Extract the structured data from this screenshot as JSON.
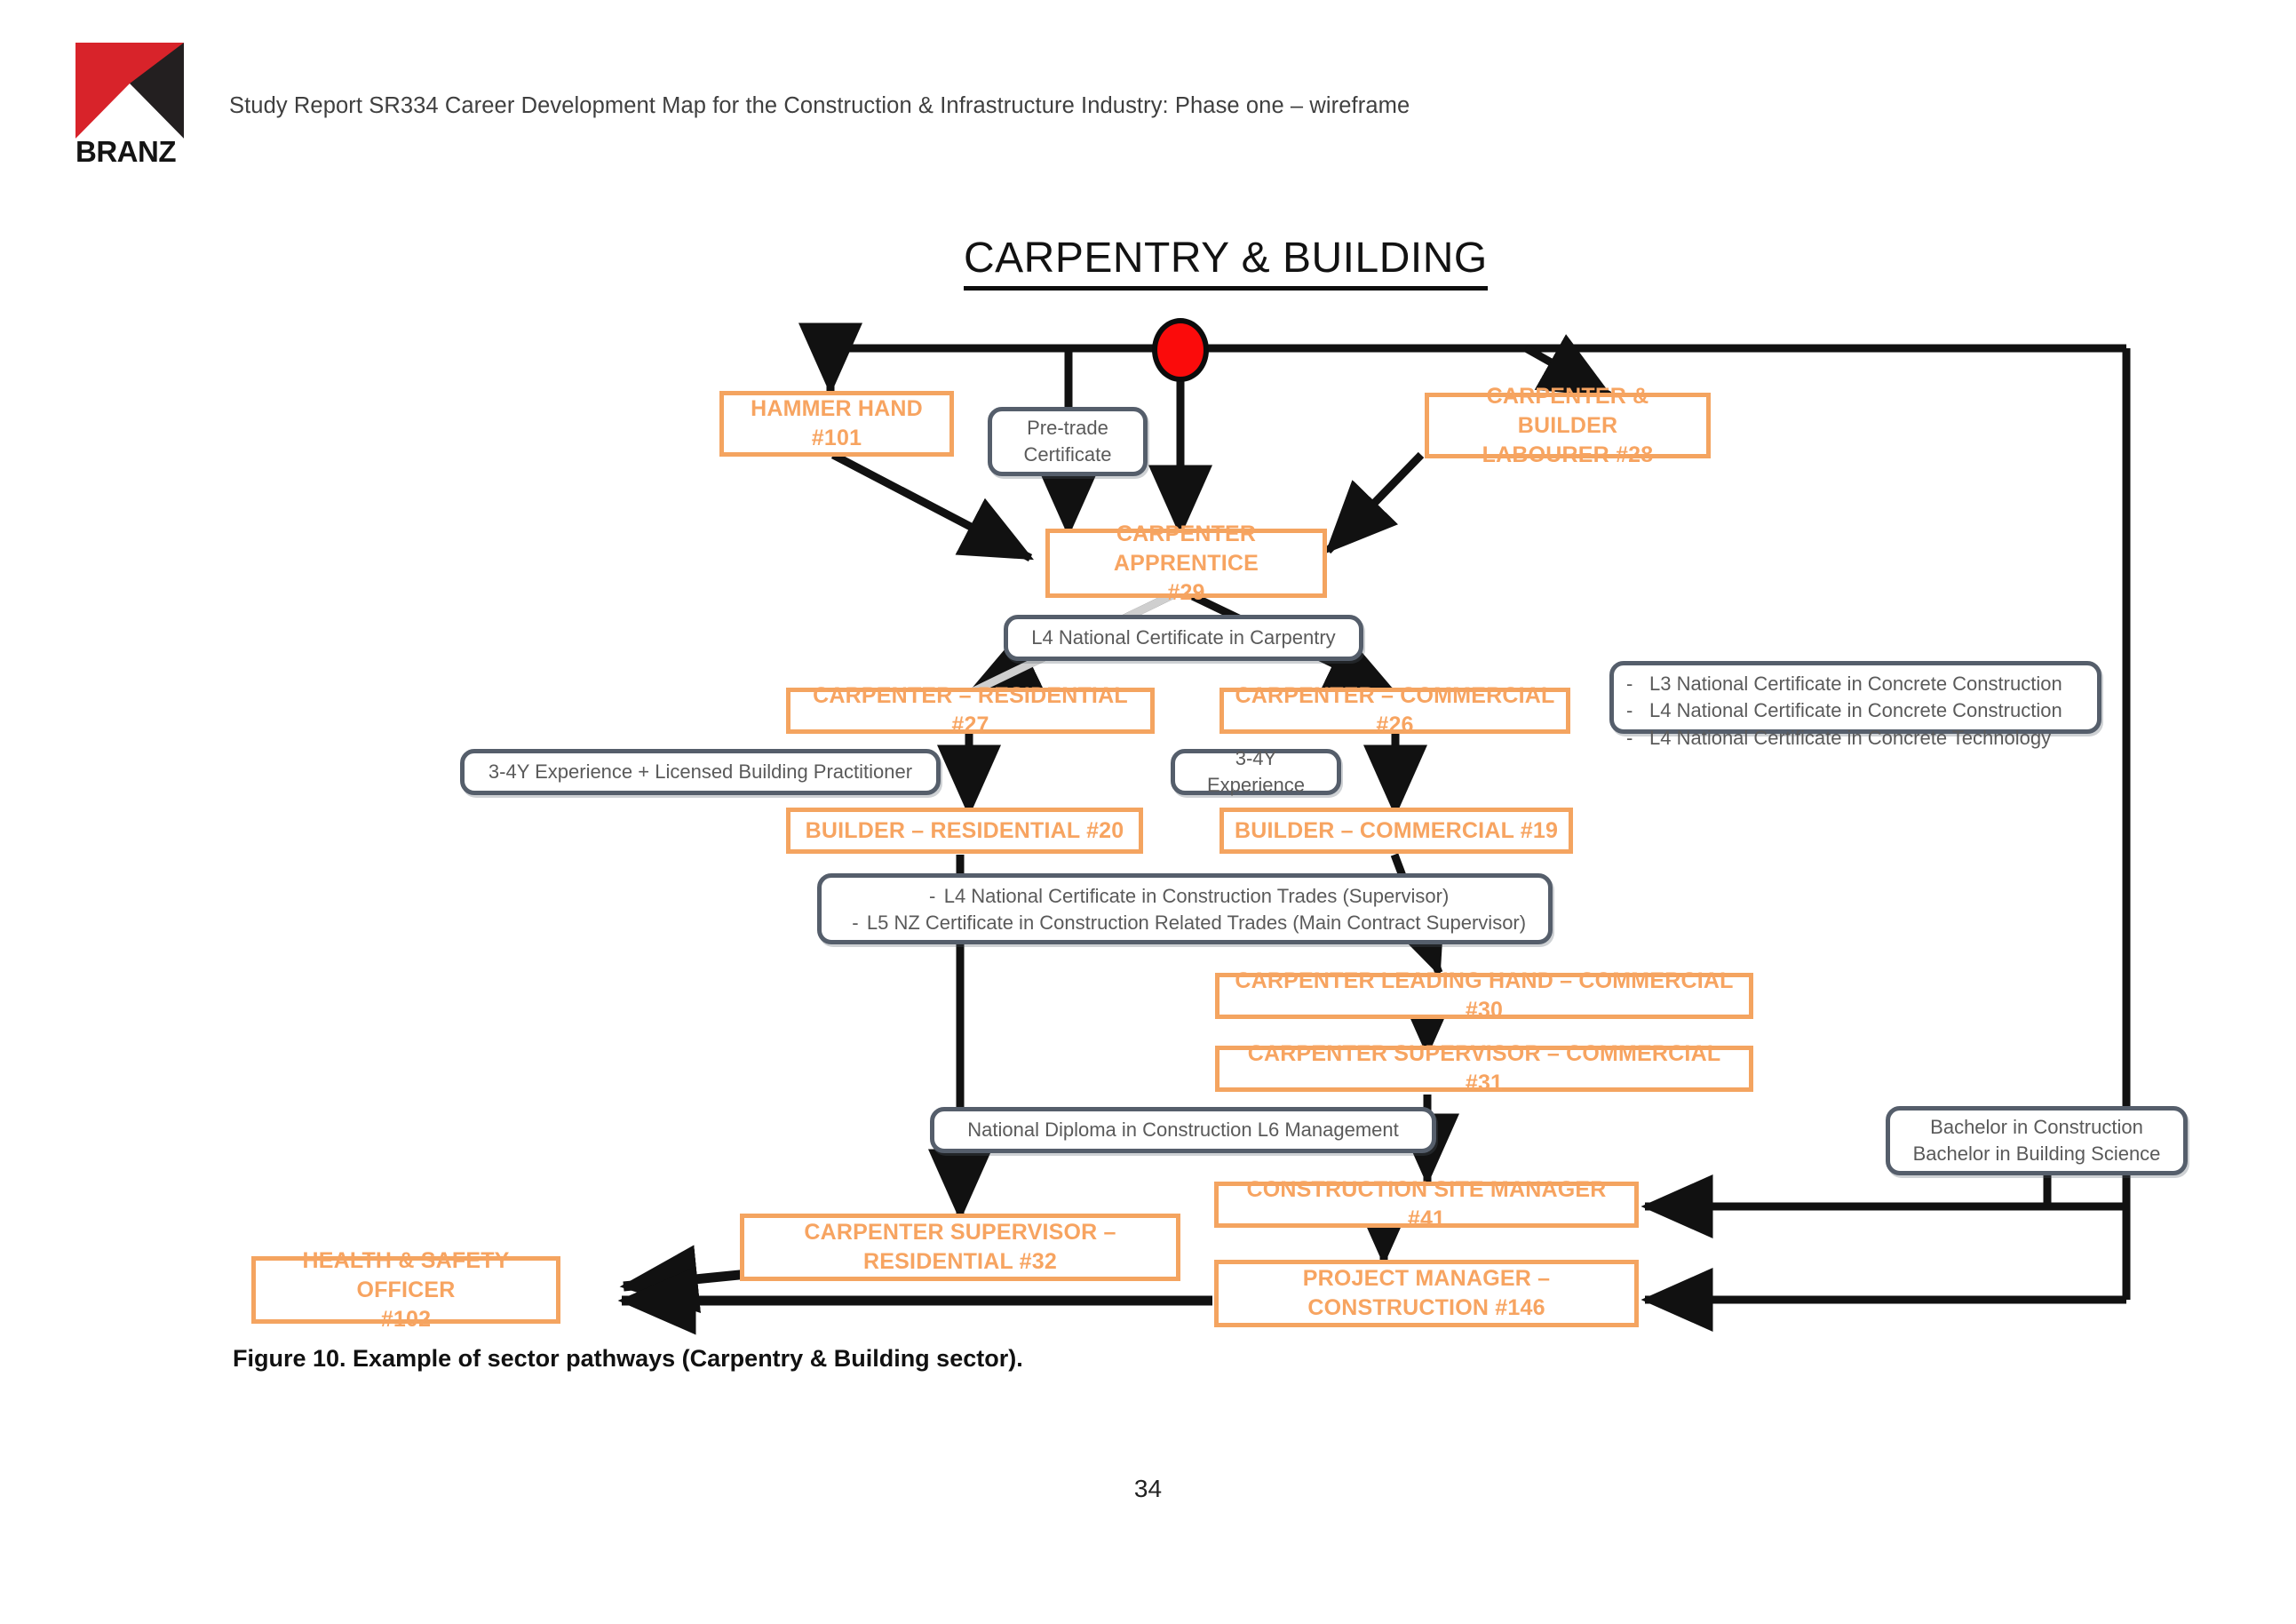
{
  "header": {
    "logo_wordmark": "BRANZ",
    "logo_icon": "branz-triangle-logo",
    "report_title": "Study Report SR334 Career Development Map for the Construction & Infrastructure Industry: Phase one – wireframe"
  },
  "diagram": {
    "section_title": "CARPENTRY & BUILDING",
    "start_marker": "red-start-node",
    "roles": [
      {
        "id": "hammer-hand",
        "label": "HAMMER HAND\n#101",
        "line1": "HAMMER HAND",
        "line2": "#101"
      },
      {
        "id": "carpenter-builder-labourer",
        "label": "CARPENTER & BUILDER LABOURER #28",
        "line1": "CARPENTER & BUILDER",
        "line2": "LABOURER #28"
      },
      {
        "id": "carpenter-apprentice",
        "label": "CARPENTER APPRENTICE #29",
        "line1": "CARPENTER APPRENTICE",
        "line2": "#29"
      },
      {
        "id": "carpenter-residential",
        "label": "CARPENTER – RESIDENTIAL #27",
        "line1": "CARPENTER – RESIDENTIAL #27",
        "line2": ""
      },
      {
        "id": "carpenter-commercial",
        "label": "CARPENTER – COMMERCIAL #26",
        "line1": "CARPENTER – COMMERCIAL #26",
        "line2": ""
      },
      {
        "id": "builder-residential",
        "label": "BUILDER – RESIDENTIAL #20",
        "line1": "BUILDER – RESIDENTIAL #20",
        "line2": ""
      },
      {
        "id": "builder-commercial",
        "label": "BUILDER – COMMERCIAL #19",
        "line1": "BUILDER – COMMERCIAL #19",
        "line2": ""
      },
      {
        "id": "carpenter-leading-hand-commercial",
        "label": "CARPENTER LEADING HAND – COMMERCIAL #30",
        "line1": "CARPENTER LEADING HAND – COMMERCIAL #30",
        "line2": ""
      },
      {
        "id": "carpenter-supervisor-commercial",
        "label": "CARPENTER SUPERVISOR – COMMERCIAL #31",
        "line1": "CARPENTER SUPERVISOR – COMMERCIAL #31",
        "line2": ""
      },
      {
        "id": "carpenter-supervisor-residential",
        "label": "CARPENTER SUPERVISOR – RESIDENTIAL #32",
        "line1": "CARPENTER SUPERVISOR –",
        "line2": "RESIDENTIAL #32"
      },
      {
        "id": "construction-site-manager",
        "label": "CONSTRUCTION SITE MANAGER #41",
        "line1": "CONSTRUCTION SITE MANAGER #41",
        "line2": ""
      },
      {
        "id": "project-manager-construction",
        "label": "PROJECT MANAGER – CONSTRUCTION #146",
        "line1": "PROJECT MANAGER –",
        "line2": "CONSTRUCTION #146"
      },
      {
        "id": "health-safety-officer",
        "label": "HEALTH & SAFETY OFFICER #102",
        "line1": "HEALTH & SAFETY OFFICER",
        "line2": "#102"
      }
    ],
    "qualifications": [
      {
        "id": "pre-trade-certificate",
        "line1": "Pre-trade",
        "line2": "Certificate"
      },
      {
        "id": "l4-national-certificate-carpentry",
        "line1": "L4 National Certificate in Carpentry"
      },
      {
        "id": "concrete-certificates",
        "line1": "L3 National Certificate in Concrete Construction",
        "line2": "L4 National Certificate in Concrete Construction",
        "line3": "L4 National Certificate in Concrete Technology"
      },
      {
        "id": "experience-lbp",
        "line1": "3-4Y Experience + Licensed Building Practitioner"
      },
      {
        "id": "experience-3-4y",
        "line1": "3-4Y Experience"
      },
      {
        "id": "construction-trades-supervisor",
        "line1": "L4 National Certificate in Construction Trades (Supervisor)",
        "line2": "L5 NZ Certificate in Construction Related Trades (Main Contract Supervisor)"
      },
      {
        "id": "national-diploma-l6",
        "line1": "National Diploma in Construction L6 Management"
      },
      {
        "id": "bachelor-degrees",
        "line1": "Bachelor in Construction",
        "line2": "Bachelor in Building Science"
      }
    ],
    "colors": {
      "role_border": "#F4A460",
      "role_text": "#F7A461",
      "qual_border": "#555E6B",
      "qual_text": "#5a5a5a",
      "start_node": "#FB0B0B",
      "edge": "#111111",
      "logo_red": "#D8232A"
    }
  },
  "caption": "Figure 10. Example of sector pathways (Carpentry & Building sector).",
  "page_number": "34"
}
